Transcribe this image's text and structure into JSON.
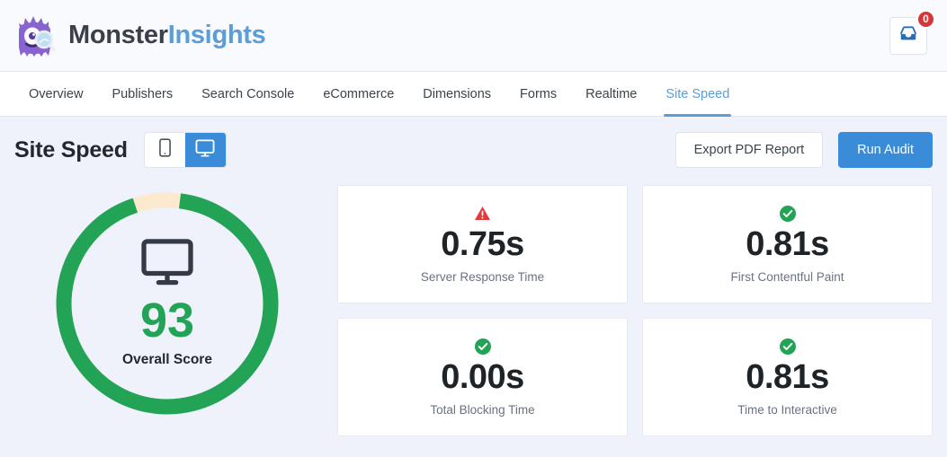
{
  "header": {
    "brand_primary": "Monster",
    "brand_secondary": "Insights",
    "logo_icon": "monster-mascot-icon",
    "inbox_icon": "inbox-icon",
    "inbox_badge_count": "0"
  },
  "nav": {
    "items": [
      {
        "label": "Overview",
        "active": false
      },
      {
        "label": "Publishers",
        "active": false
      },
      {
        "label": "Search Console",
        "active": false
      },
      {
        "label": "eCommerce",
        "active": false
      },
      {
        "label": "Dimensions",
        "active": false
      },
      {
        "label": "Forms",
        "active": false
      },
      {
        "label": "Realtime",
        "active": false
      },
      {
        "label": "Site Speed",
        "active": true
      }
    ]
  },
  "toolbar": {
    "title": "Site Speed",
    "device_toggle": {
      "mobile_icon": "mobile-phone-icon",
      "desktop_icon": "desktop-monitor-icon",
      "selected": "desktop"
    },
    "export_label": "Export PDF Report",
    "run_audit_label": "Run Audit"
  },
  "gauge": {
    "score": "93",
    "label": "Overall Score",
    "device_icon": "desktop-monitor-icon",
    "percent": 93,
    "arc_color": "#23a356",
    "track_color": "#fceace"
  },
  "metrics": [
    {
      "value": "0.75s",
      "name": "Server Response Time",
      "status": "warning",
      "icon": "warning-triangle-icon"
    },
    {
      "value": "0.81s",
      "name": "First Contentful Paint",
      "status": "good",
      "icon": "check-circle-icon"
    },
    {
      "value": "0.00s",
      "name": "Total Blocking Time",
      "status": "good",
      "icon": "check-circle-icon"
    },
    {
      "value": "0.81s",
      "name": "Time to Interactive",
      "status": "good",
      "icon": "check-circle-icon"
    }
  ],
  "colors": {
    "accent_blue": "#3a8bd8",
    "brand_blue": "#5b9dd9",
    "success_green": "#23a356",
    "warning_red": "#d63638",
    "page_bg": "#f0f2fb"
  }
}
